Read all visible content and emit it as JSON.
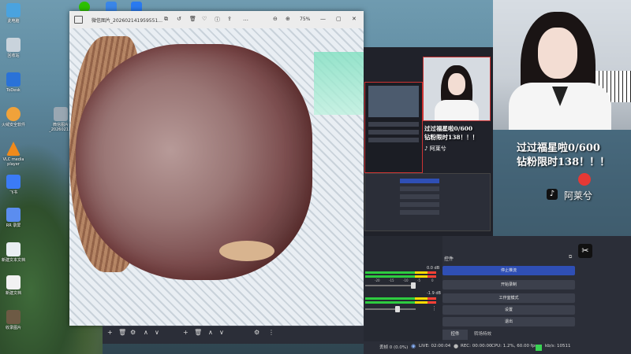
{
  "desktop": {
    "icons": [
      {
        "label": "此电脑",
        "color": "#4aa3df"
      },
      {
        "label": "回收站",
        "color": "#c9d3dc"
      },
      {
        "label": "ToDesk",
        "color": "#2a72d8"
      },
      {
        "label": "火绒安全软件",
        "color": "#f0a23a"
      },
      {
        "label": "微信图片_2026021...",
        "color": "#9aa7b2"
      },
      {
        "label": "VLC media player",
        "color": "#f08a1c"
      },
      {
        "label": "飞书",
        "color": "#3b7bf6"
      },
      {
        "label": "RR 录屏",
        "color": "#5b8def"
      },
      {
        "label": "新建文本文档",
        "color": "#e9eef2"
      },
      {
        "label": "新建文档",
        "color": "#f2f2f2"
      },
      {
        "label": "收录图片",
        "color": "#6d5a44"
      }
    ]
  },
  "taskbar_top": {
    "apps": [
      "wechat-icon",
      "photos-icon",
      "feishu-icon"
    ]
  },
  "viewer": {
    "title": "微信图片_202602141959551...",
    "zoom": "75%"
  },
  "obs": {
    "controls_title": "控件",
    "buttons": [
      "停止推流",
      "开始录制",
      "工作室模式",
      "设置",
      "退出"
    ],
    "tabs": [
      "控件",
      "转场特效"
    ],
    "audio": [
      {
        "db": "0.0 dB"
      },
      {
        "db": "-1.9 dB"
      }
    ],
    "meter_ticks": [
      "-20",
      "-15",
      "-10",
      "-5",
      "0"
    ],
    "status": {
      "frames": "丢帧 0 (0.0%)",
      "live": "LIVE: 02:00:04",
      "rec": "REC: 00:00:00",
      "cpu": "CPU: 1.2%, 60.00 fps",
      "bitrate": "kb/s: 10511"
    }
  },
  "overlay": {
    "line1": "过过福星啦0/600",
    "line2": "钻粉限时138！！！",
    "douyin_label": "阿莱兮",
    "mini_line1": "过过福星啦0/600",
    "mini_line2": "钻粉限时138！！！",
    "mini_label": "阿莱兮"
  },
  "colors": {
    "obs_accent": "#2f4fb5",
    "obs_panel": "#2b2e38",
    "live_green": "#39d353"
  }
}
